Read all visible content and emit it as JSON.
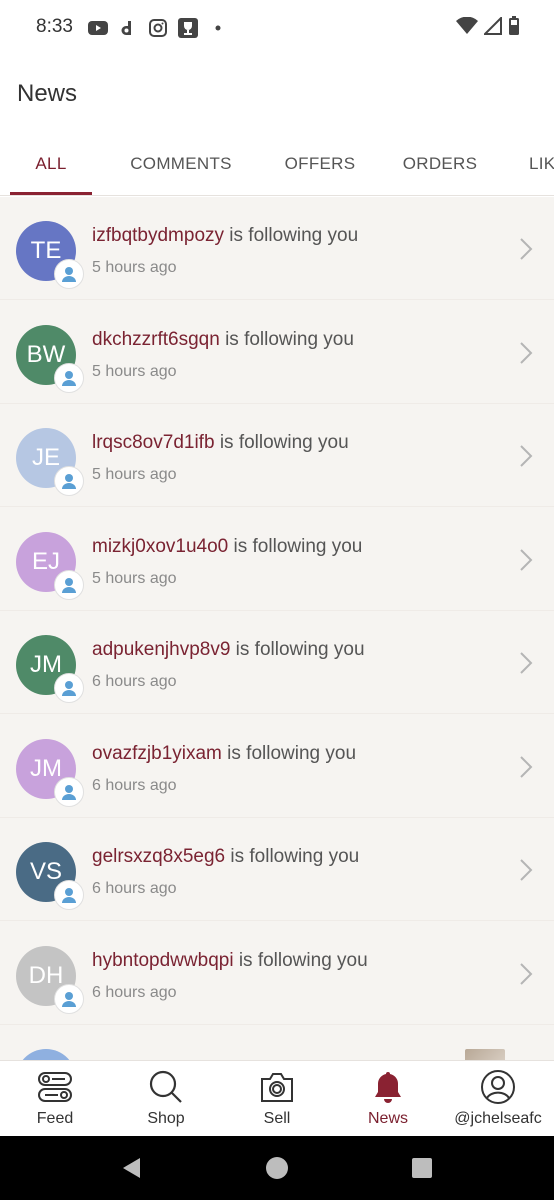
{
  "status_bar": {
    "time": "8:33",
    "left_icons": [
      "youtube-icon",
      "dailymotion-icon",
      "instagram-icon",
      "trophy-icon",
      "dot-icon"
    ],
    "right_icons": [
      "wifi-icon",
      "signal-icon",
      "battery-icon"
    ]
  },
  "header": {
    "title": "News"
  },
  "tabs": [
    {
      "label": "ALL",
      "active": true
    },
    {
      "label": "COMMENTS",
      "active": false
    },
    {
      "label": "OFFERS",
      "active": false
    },
    {
      "label": "ORDERS",
      "active": false
    },
    {
      "label": "LIK",
      "active": false
    }
  ],
  "notifications": [
    {
      "initials": "TE",
      "avatar_color": "#6676c4",
      "username": "izfbqtbydmpozy",
      "action": "is following you",
      "time": "5 hours ago"
    },
    {
      "initials": "BW",
      "avatar_color": "#4f8a68",
      "username": "dkchzzrft6sgqn",
      "action": "is following you",
      "time": "5 hours ago"
    },
    {
      "initials": "JE",
      "avatar_color": "#b6c7e3",
      "username": "lrqsc8ov7d1ifb",
      "action": "is following you",
      "time": "5 hours ago"
    },
    {
      "initials": "EJ",
      "avatar_color": "#c8a2dc",
      "username": "mizkj0xov1u4o0",
      "action": "is following you",
      "time": "5 hours ago"
    },
    {
      "initials": "JM",
      "avatar_color": "#4f8a68",
      "username": "adpukenjhvp8v9",
      "action": "is following you",
      "time": "6 hours ago"
    },
    {
      "initials": "JM",
      "avatar_color": "#c8a2dc",
      "username": "ovazfzjb1yixam",
      "action": "is following you",
      "time": "6 hours ago"
    },
    {
      "initials": "VS",
      "avatar_color": "#4a6b85",
      "username": "gelrsxzq8x5eg6",
      "action": "is following you",
      "time": "6 hours ago"
    },
    {
      "initials": "DH",
      "avatar_color": "#c4c4c4",
      "username": "hybntopdwwbqpi",
      "action": "is following you",
      "time": "6 hours ago"
    }
  ],
  "bottom_nav": [
    {
      "label": "Feed",
      "icon": "feed-icon",
      "active": false
    },
    {
      "label": "Shop",
      "icon": "search-icon",
      "active": false
    },
    {
      "label": "Sell",
      "icon": "camera-icon",
      "active": false
    },
    {
      "label": "News",
      "icon": "bell-icon",
      "active": true
    },
    {
      "label": "@jchelseafc",
      "icon": "profile-icon",
      "active": false
    }
  ],
  "colors": {
    "accent": "#7a1f2e",
    "list_background": "#f6f4f1"
  }
}
